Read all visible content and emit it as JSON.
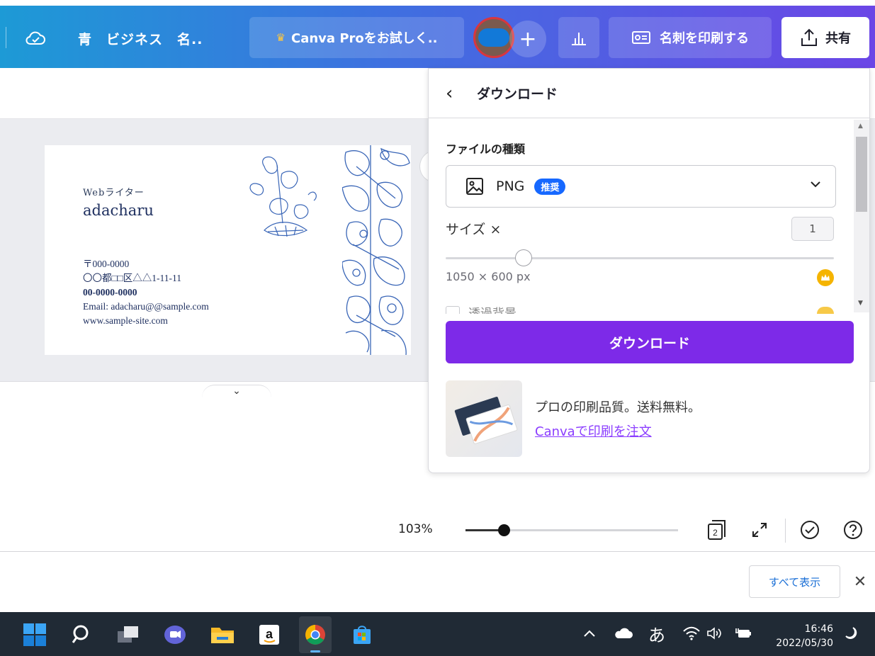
{
  "topbar": {
    "title": "青　ビジネス　名..",
    "pro_label": "Canva Proをお試しく..",
    "print_label": "名刺を印刷する",
    "share_label": "共有",
    "plus_label": "+"
  },
  "card": {
    "role": "Webライター",
    "name": "adacharu",
    "postal": "〒000-0000",
    "address": "〇〇都□□区△△1-11-11",
    "phone": "00-0000-0000",
    "email": "Email: adacharu@@sample.com",
    "website": "www.sample-site.com"
  },
  "download_panel": {
    "title": "ダウンロード",
    "file_type_label": "ファイルの種類",
    "file_type_value": "PNG",
    "file_type_badge": "推奨",
    "size_label": "サイズ ×",
    "size_value": "1",
    "size_fraction": 0.2,
    "dimensions": "1050 × 600 px",
    "transparent_label": "透過背景",
    "download_button": "ダウンロード",
    "promo_text": "プロの印刷品質。送料無料。",
    "promo_link": "Canvaで印刷を注文"
  },
  "zoom": {
    "percent": "103%",
    "fraction": 0.18,
    "pages_count": "2"
  },
  "download_shelf": {
    "show_all": "すべて表示",
    "close": "✕"
  },
  "taskbar": {
    "ime": "あ",
    "time": "16:46",
    "date": "2022/05/30",
    "chevron": "^"
  },
  "colors": {
    "accent_purple": "#7d2ae8",
    "link_purple": "#8b3dff",
    "recommend_blue": "#1668ff",
    "card_ink": "#1f3060"
  }
}
